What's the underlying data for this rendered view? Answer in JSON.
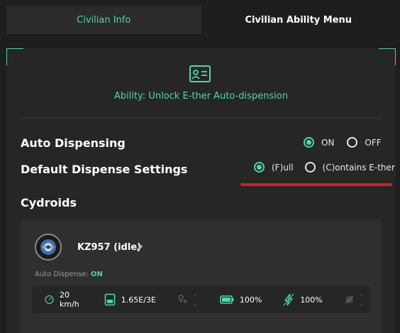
{
  "tabs": [
    {
      "label": "Civilian Info",
      "active": false
    },
    {
      "label": "Civilian Ability Menu",
      "active": true
    }
  ],
  "panel": {
    "icon": "id-card-icon",
    "ability_text": "Ability: Unlock E-ther Auto-dispension"
  },
  "auto_dispensing": {
    "label": "Auto Dispensing",
    "options": [
      "ON",
      "OFF"
    ],
    "selected": "ON"
  },
  "default_dispense": {
    "label": "Default Dispense Settings",
    "options": [
      "(F)ull",
      "(C)ontains E-ther"
    ],
    "selected": "(F)ull"
  },
  "cydroids": {
    "title": "Cydroids",
    "unit": {
      "name": "KZ957 (idle)",
      "auto_dispense_label": "Auto Dispense:",
      "auto_dispense_value": "ON",
      "stats": [
        {
          "icon": "speedometer-icon",
          "value": "20 km/h"
        },
        {
          "icon": "tank-icon",
          "value": "1.65E/3E"
        },
        {
          "icon": "location-icon",
          "value": "--"
        },
        {
          "icon": "battery-icon",
          "value": "100%"
        },
        {
          "icon": "bolt-icon",
          "value": "100%"
        },
        {
          "icon": "signal-icon",
          "value": "--"
        }
      ]
    }
  },
  "colors": {
    "accent": "#4fd6b0",
    "background": "#1e1e1e",
    "panel": "#262626",
    "card": "#2f2f2f",
    "annotation_red": "#e01a1a"
  }
}
